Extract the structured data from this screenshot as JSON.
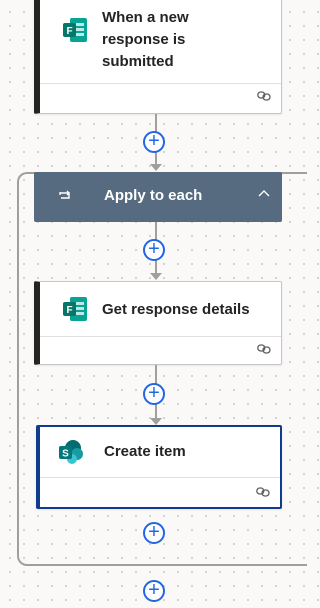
{
  "trigger": {
    "title": "When a new response is submitted"
  },
  "apply_to_each": {
    "title": "Apply to each"
  },
  "actions": [
    {
      "title": "Get response details"
    },
    {
      "title": "Create item"
    }
  ],
  "icons": {
    "forms": "forms-icon",
    "sharepoint": "sharepoint-icon",
    "link": "link-icon",
    "loop": "loop-icon",
    "collapse": "chevron-up-icon",
    "add": "add-step-icon"
  },
  "colors": {
    "accent": "#2266e3",
    "forms_green": "#077568",
    "sharepoint_teal": "#036c70",
    "scope_header": "#566a80",
    "card_left_border": "#252423",
    "selected_border": "#0f3c8c"
  }
}
